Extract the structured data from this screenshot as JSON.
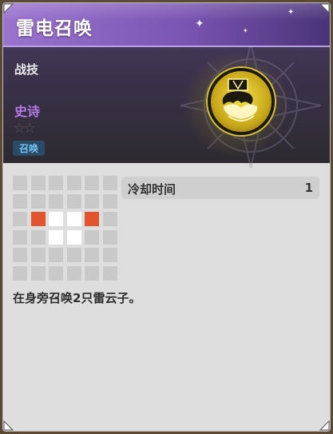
{
  "skill": {
    "title": "雷电召唤",
    "category": "战技",
    "rarity": "史诗",
    "stars": "☆☆",
    "tag": "召唤",
    "cooldown_label": "冷却时间",
    "cooldown_value": "1",
    "description": "在身旁召唤2只雷云子。"
  },
  "range_grid": {
    "rows": 6,
    "cols": 6,
    "cells": [
      [
        "empty",
        "empty",
        "empty",
        "empty",
        "empty",
        "empty"
      ],
      [
        "empty",
        "empty",
        "empty",
        "empty",
        "empty",
        "empty"
      ],
      [
        "empty",
        "target",
        "self",
        "self",
        "target",
        "empty"
      ],
      [
        "empty",
        "empty",
        "self",
        "self",
        "empty",
        "empty"
      ],
      [
        "empty",
        "empty",
        "empty",
        "empty",
        "empty",
        "empty"
      ],
      [
        "empty",
        "empty",
        "empty",
        "empty",
        "empty",
        "empty"
      ]
    ]
  },
  "icons": {
    "emblem": "thunder-summon-icon",
    "sparkle": "sparkle-icon"
  },
  "colors": {
    "title_bar": "#7a55b3",
    "rarity_text": "#b47ae6",
    "tag_text": "#6ec3f0",
    "tag_bg": "#2a4a66",
    "target_cell": "#e2542b",
    "self_cell": "#ffffff",
    "empty_cell": "#c9c9c9",
    "emblem_gold": "#f4e24a"
  }
}
